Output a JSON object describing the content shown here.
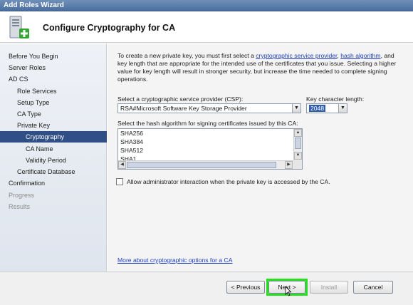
{
  "window": {
    "title": "Add Roles Wizard"
  },
  "header": {
    "title": "Configure Cryptography for CA",
    "icon": "server-add-icon"
  },
  "nav": {
    "items": [
      {
        "label": "Before You Begin",
        "level": 0,
        "state": "normal"
      },
      {
        "label": "Server Roles",
        "level": 0,
        "state": "normal"
      },
      {
        "label": "AD CS",
        "level": 0,
        "state": "normal"
      },
      {
        "label": "Role Services",
        "level": 1,
        "state": "normal"
      },
      {
        "label": "Setup Type",
        "level": 1,
        "state": "normal"
      },
      {
        "label": "CA Type",
        "level": 1,
        "state": "normal"
      },
      {
        "label": "Private Key",
        "level": 1,
        "state": "normal"
      },
      {
        "label": "Cryptography",
        "level": 2,
        "state": "selected"
      },
      {
        "label": "CA Name",
        "level": 2,
        "state": "normal"
      },
      {
        "label": "Validity Period",
        "level": 2,
        "state": "normal"
      },
      {
        "label": "Certificate Database",
        "level": 1,
        "state": "normal"
      },
      {
        "label": "Confirmation",
        "level": 0,
        "state": "normal"
      },
      {
        "label": "Progress",
        "level": 0,
        "state": "disabled"
      },
      {
        "label": "Results",
        "level": 0,
        "state": "disabled"
      }
    ]
  },
  "intro": {
    "part1": "To create a new private key, you must first select a ",
    "link1": "cryptographic service provider",
    "part2": ", ",
    "link2": "hash algorithm",
    "part3": ", and key length that are appropriate for the intended use of the certificates that you issue. Selecting a higher value for key length will result in stronger security, but increase the time needed to complete signing operations."
  },
  "csp": {
    "label": "Select a cryptographic service provider (CSP):",
    "value": "RSA#Microsoft Software Key Storage Provider"
  },
  "key_length": {
    "label": "Key character length:",
    "value": "2048"
  },
  "hash": {
    "label": "Select the hash algorithm for signing certificates issued by this CA:",
    "items": [
      "SHA256",
      "SHA384",
      "SHA512",
      "SHA1"
    ]
  },
  "checkbox": {
    "label": "Allow administrator interaction when the private key is accessed by the CA.",
    "checked": false
  },
  "more_link": "More about cryptographic options for a CA",
  "buttons": {
    "previous": "< Previous",
    "next": "Next >",
    "install": "Install",
    "cancel": "Cancel"
  },
  "colors": {
    "title_bar": "#4a6fa0",
    "nav_selected": "#2f4f86",
    "link": "#1f3fbf",
    "highlight": "#25e020"
  }
}
